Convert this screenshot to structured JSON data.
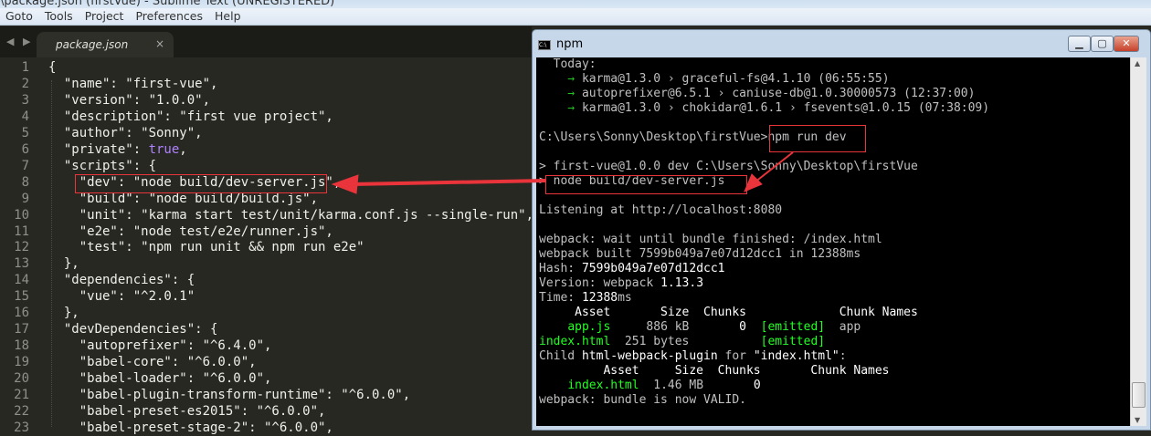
{
  "window_title": "\\package.json (firstVue) - Sublime Text (UNREGISTERED)",
  "menu": [
    "Goto",
    "Tools",
    "Project",
    "Preferences",
    "Help"
  ],
  "editor": {
    "nav_arrows": "◀ ▶",
    "tab_label": "package.json",
    "tab_close": "×",
    "lines": [
      [
        {
          "t": "{"
        }
      ],
      [
        {
          "t": "  \"name\": \"first-vue\","
        }
      ],
      [
        {
          "t": "  \"version\": \"1.0.0\","
        }
      ],
      [
        {
          "t": "  \"description\": \"first vue project\","
        }
      ],
      [
        {
          "t": "  \"author\": \"Sonny\","
        }
      ],
      [
        {
          "t": "  \"private\": "
        },
        {
          "t": "true",
          "c": "#ae81ff"
        },
        {
          "t": ","
        }
      ],
      [
        {
          "t": "  \"scripts\": {"
        }
      ],
      [
        {
          "t": "    \"dev\": \"node build/dev-server.js\","
        }
      ],
      [
        {
          "t": "    \"build\": \"node build/build.js\","
        }
      ],
      [
        {
          "t": "    \"unit\": \"karma start test/unit/karma.conf.js --single-run\","
        }
      ],
      [
        {
          "t": "    \"e2e\": \"node test/e2e/runner.js\","
        }
      ],
      [
        {
          "t": "    \"test\": \"npm run unit && npm run e2e\""
        }
      ],
      [
        {
          "t": "  },"
        }
      ],
      [
        {
          "t": "  \"dependencies\": {"
        }
      ],
      [
        {
          "t": "    \"vue\": \"^2.0.1\""
        }
      ],
      [
        {
          "t": "  },"
        }
      ],
      [
        {
          "t": "  \"devDependencies\": {"
        }
      ],
      [
        {
          "t": "    \"autoprefixer\": \"^6.4.0\","
        }
      ],
      [
        {
          "t": "    \"babel-core\": \"^6.0.0\","
        }
      ],
      [
        {
          "t": "    \"babel-loader\": \"^6.0.0\","
        }
      ],
      [
        {
          "t": "    \"babel-plugin-transform-runtime\": \"^6.0.0\","
        }
      ],
      [
        {
          "t": "    \"babel-preset-es2015\": \"^6.0.0\","
        }
      ],
      [
        {
          "t": "    \"babel-preset-stage-2\": \"^6.0.0\","
        }
      ]
    ]
  },
  "terminal": {
    "title": "npm",
    "icon_text": "C:\\",
    "buttons": {
      "minimize": "▁",
      "maximize": "▢",
      "close": "✕"
    },
    "lines": [
      [
        {
          "t": "  Today:"
        }
      ],
      [
        {
          "t": "    → ",
          "c": "#22c322"
        },
        {
          "t": "karma@1.3.0 › graceful-fs@4.1.10 (06:55:55)"
        }
      ],
      [
        {
          "t": "    → ",
          "c": "#22c322"
        },
        {
          "t": "autoprefixer@6.5.1 › caniuse-db@1.0.30000573 (12:37:00)"
        }
      ],
      [
        {
          "t": "    → ",
          "c": "#22c322"
        },
        {
          "t": "karma@1.3.0 › chokidar@1.6.1 › fsevents@1.0.15 (07:38:09)"
        }
      ],
      [
        {
          "t": ""
        }
      ],
      [
        {
          "t": "C:\\Users\\Sonny\\Desktop\\firstVue>npm run dev"
        }
      ],
      [
        {
          "t": ""
        }
      ],
      [
        {
          "t": "> first-vue@1.0.0 dev C:\\Users\\Sonny\\Desktop\\firstVue"
        }
      ],
      [
        {
          "t": "> node build/dev-server.js"
        }
      ],
      [
        {
          "t": ""
        }
      ],
      [
        {
          "t": "Listening at http://localhost:8080"
        }
      ],
      [
        {
          "t": ""
        }
      ],
      [
        {
          "t": "webpack: wait until bundle finished: /index.html"
        }
      ],
      [
        {
          "t": "webpack built 7599b049a7e07d12dcc1 in 12388ms"
        }
      ],
      [
        {
          "t": "Hash: "
        },
        {
          "t": "7599b049a7e07d12dcc1",
          "c": "#ffffff"
        }
      ],
      [
        {
          "t": "Version: webpack "
        },
        {
          "t": "1.13.3",
          "c": "#ffffff"
        }
      ],
      [
        {
          "t": "Time: "
        },
        {
          "t": "12388",
          "c": "#ffffff"
        },
        {
          "t": "ms"
        }
      ],
      [
        {
          "t": "     Asset       Size  Chunks             Chunk Names",
          "c": "#ffffff"
        }
      ],
      [
        {
          "t": "    "
        },
        {
          "t": "app.js",
          "c": "#22ff22"
        },
        {
          "t": "     886 kB       "
        },
        {
          "t": "0",
          "c": "#ffffff"
        },
        {
          "t": "  "
        },
        {
          "t": "[emitted]",
          "c": "#22ff22"
        },
        {
          "t": "  app"
        }
      ],
      [
        {
          "t": "index.html",
          "c": "#22ff22"
        },
        {
          "t": "  251 bytes          "
        },
        {
          "t": "[emitted]",
          "c": "#22ff22"
        }
      ],
      [
        {
          "t": "Child "
        },
        {
          "t": "html-webpack-plugin",
          "c": "#ffffff"
        },
        {
          "t": " for "
        },
        {
          "t": "\"index.html\"",
          "c": "#ffffff"
        },
        {
          "t": ":"
        }
      ],
      [
        {
          "t": "         Asset     Size  Chunks       Chunk Names",
          "c": "#ffffff"
        }
      ],
      [
        {
          "t": "    "
        },
        {
          "t": "index.html",
          "c": "#22ff22"
        },
        {
          "t": "  1.46 MB       "
        },
        {
          "t": "0",
          "c": "#ffffff"
        }
      ],
      [
        {
          "t": "webpack: bundle is now VALID."
        }
      ],
      [
        {
          "t": ""
        }
      ],
      [
        {
          "t": "_"
        }
      ]
    ]
  },
  "colors": {
    "annotation": "#e8343a",
    "editor_bg": "#272822",
    "terminal_bg": "#000000"
  }
}
